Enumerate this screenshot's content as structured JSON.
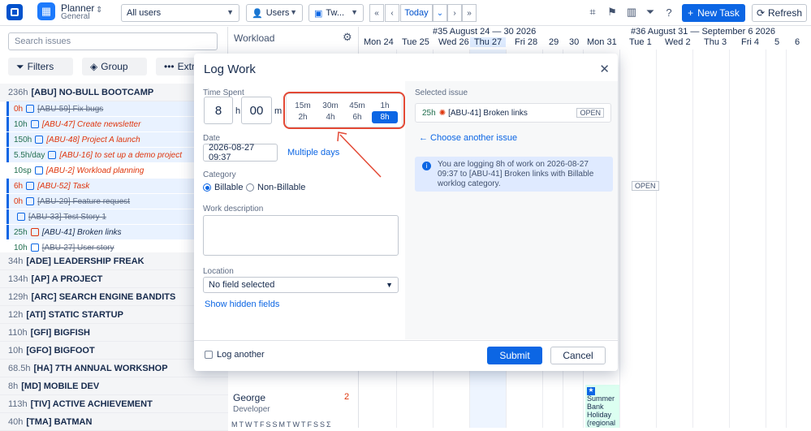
{
  "topbar": {
    "app_title": "Planner",
    "app_subtitle": "General",
    "users_select": "All users",
    "users_button": "Users",
    "view_select": "Tw...",
    "today": "Today",
    "new_task": "New Task",
    "refresh": "Refresh"
  },
  "left": {
    "search_placeholder": "Search issues",
    "filters": "Filters",
    "group": "Group",
    "extra": "Extr",
    "groups": [
      {
        "hours": "236h",
        "name": "[ABU] NO-BULL BOOTCAMP"
      },
      {
        "hours": "34h",
        "name": "[ADE] LEADERSHIP FREAK"
      },
      {
        "hours": "134h",
        "name": "[AP] A PROJECT"
      },
      {
        "hours": "129h",
        "name": "[ARC] SEARCH ENGINE BANDITS"
      },
      {
        "hours": "12h",
        "name": "[ATI] STATIC STARTUP"
      },
      {
        "hours": "110h",
        "name": "[GFI] BIGFISH"
      },
      {
        "hours": "10h",
        "name": "[GFO] BIGFOOT"
      },
      {
        "hours": "68.5h",
        "name": "[HA] 7TH ANNUAL WORKSHOP"
      },
      {
        "hours": "8h",
        "name": "[MD] MOBILE DEV"
      },
      {
        "hours": "113h",
        "name": "[TIV] ACTIVE ACHIEVEMENT"
      },
      {
        "hours": "40h",
        "name": "[TMA] BATMAN"
      }
    ],
    "tasks": [
      {
        "hours": "0h",
        "name": "[ABU-59] Fix bugs"
      },
      {
        "hours": "10h",
        "name": "[ABU-47] Create newsletter"
      },
      {
        "hours": "150h",
        "name": "[ABU-48] Project A launch"
      },
      {
        "hours": "5.5h/day",
        "name": "[ABU-16] to set up a demo project"
      },
      {
        "hours": "10sp",
        "name": "[ABU-2] Workload planning"
      },
      {
        "hours": "6h",
        "name": "[ABU-52] Task"
      },
      {
        "hours": "0h",
        "name": "[ABU-29] Feature request"
      },
      {
        "hours": "",
        "name": "[ABU-33] Test Story 1"
      },
      {
        "hours": "25h",
        "name": "[ABU-41] Broken links"
      },
      {
        "hours": "10h",
        "name": "[ABU-27] User story"
      }
    ]
  },
  "center": {
    "workload": "Workload",
    "person_name": "George",
    "person_role": "Developer",
    "person_count": "2",
    "weekdays": "MTWTFSSMTWTFSSΣ"
  },
  "calendar": {
    "week1": "#35 August 24 — 30 2026",
    "week2": "#36 August 31 — September 6 2026",
    "days": [
      "Mon 24",
      "Tue 25",
      "Wed 26",
      "Thu 27",
      "Fri 28",
      "29",
      "30",
      "Mon 31",
      "Tue 1",
      "Wed 2",
      "Thu 3",
      "Fri 4",
      "5",
      "6"
    ],
    "holiday": "Summer Bank Holiday (regional",
    "open_tag": "OPEN"
  },
  "modal": {
    "title": "Log Work",
    "time_spent_label": "Time Spent",
    "hours_value": "8",
    "hours_unit": "h",
    "minutes_value": "00",
    "minutes_unit": "m",
    "quick_options": [
      "15m",
      "30m",
      "45m",
      "1h",
      "2h",
      "4h",
      "6h",
      "8h"
    ],
    "date_label": "Date",
    "date_value": "2026-08-27 09:37",
    "multiple_days": "Multiple days",
    "category_label": "Category",
    "billable": "Billable",
    "non_billable": "Non-Billable",
    "work_description_label": "Work description",
    "location_label": "Location",
    "location_value": "No field selected",
    "show_hidden": "Show hidden fields",
    "selected_issue_label": "Selected issue",
    "selected_issue_hours": "25h",
    "selected_issue_name": "[ABU-41] Broken links",
    "selected_issue_status": "OPEN",
    "choose_another": "← Choose another issue",
    "info_text": "You are logging 8h of work on 2026-08-27 09:37 to [ABU-41] Broken links with Billable worklog category.",
    "log_another": "Log another",
    "submit": "Submit",
    "cancel": "Cancel"
  },
  "colors": {
    "accent": "#0c66e4",
    "highlight": "#e34935"
  }
}
